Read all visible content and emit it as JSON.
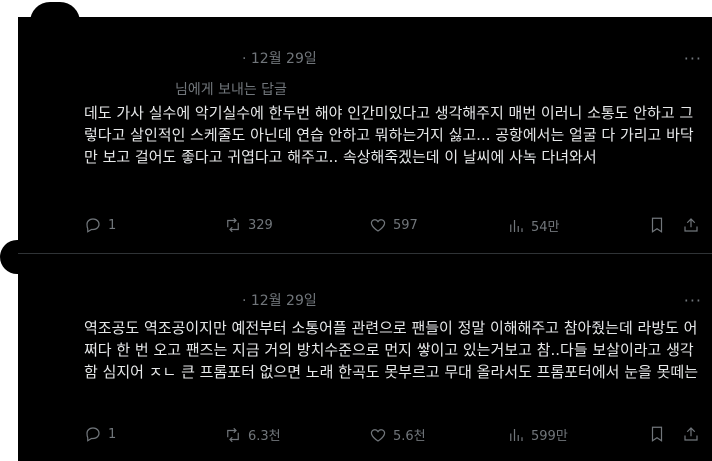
{
  "posts": [
    {
      "time": "· 12월 29일",
      "more": "···",
      "reply_to": "님에게 보내는 답글",
      "text": "데도 가사 실수에 악기실수에 한두번 해야 인간미있다고 생각해주지 매번 이러니 소통도 안하고 그렇다고 살인적인 스케줄도 아닌데 연습 안하고 뭐하는거지 싫고... 공항에서는 얼굴 다 가리고 바닥만 보고 걸어도 좋다고 귀엽다고 해주고.. 속상해죽겠는데 이 날씨에 사녹 다녀와서",
      "replies": "1",
      "reposts": "329",
      "likes": "597",
      "views": "54만"
    },
    {
      "time": "· 12월 29일",
      "more": "···",
      "text": "역조공도 역조공이지만 예전부터 소통어플 관련으로 팬들이 정말 이해해주고 참아줬는데 라방도 어쩌다 한 번 오고 팬즈는 지금 거의 방치수준으로 먼지 쌓이고 있는거보고 참..다들 보살이라고 생각함 심지어 ㅈㄴ 큰 프롬포터 없으면 노래 한곡도 못부르고 무대 올라서도 프롬포터에서 눈을 못떼는",
      "replies": "1",
      "reposts": "6.3천",
      "likes": "5.6천",
      "views": "599만"
    }
  ],
  "icons": {
    "reply": "reply-icon",
    "repost": "repost-icon",
    "like": "heart-icon",
    "views": "views-icon",
    "bookmark": "bookmark-icon",
    "share": "share-icon"
  },
  "colors": {
    "background": "#000000",
    "text": "#e7e9ea",
    "muted": "#71767b"
  }
}
